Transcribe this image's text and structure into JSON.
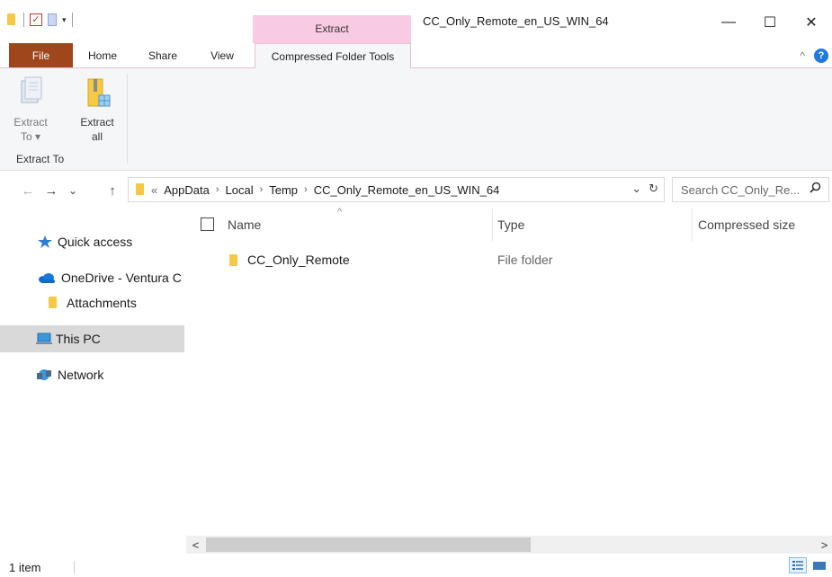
{
  "window": {
    "title": "CC_Only_Remote_en_US_WIN_64",
    "context_tab_header": "Extract",
    "controls": {
      "minimize": "—",
      "maximize": "☐",
      "close": "✕"
    }
  },
  "quick_access_toolbar": {
    "dropdown_glyph": "▾"
  },
  "ribbon": {
    "tabs": [
      "File",
      "Home",
      "Share",
      "View",
      "Compressed Folder Tools"
    ],
    "active_tab": "Compressed Folder Tools",
    "collapse_glyph": "^",
    "help_glyph": "?",
    "extract_to": {
      "line1": "Extract",
      "line2": "To ▾"
    },
    "extract_all": {
      "line1": "Extract",
      "line2": "all"
    },
    "group_label": "Extract To"
  },
  "navigation": {
    "back": "←",
    "forward": "→",
    "recent": "⌄",
    "up": "↑",
    "address": {
      "overflow": "«",
      "separator": "›",
      "crumbs": [
        "AppData",
        "Local",
        "Temp",
        "CC_Only_Remote_en_US_WIN_64"
      ],
      "dropdown": "⌄",
      "refresh": "↻"
    },
    "search_placeholder": "Search CC_Only_Re...",
    "search_icon": "⌕"
  },
  "nav_pane": {
    "items": [
      {
        "label": "Quick access",
        "icon": "star-icon"
      },
      {
        "label": "OneDrive - Ventura C",
        "icon": "cloud-icon"
      },
      {
        "label": "Attachments",
        "icon": "folder-icon"
      },
      {
        "label": "This PC",
        "icon": "computer-icon"
      },
      {
        "label": "Network",
        "icon": "network-icon"
      }
    ],
    "selected": "This PC"
  },
  "file_list": {
    "columns": [
      "Name",
      "Type",
      "Compressed size"
    ],
    "sort_indicator": "^",
    "rows": [
      {
        "name": "CC_Only_Remote",
        "type": "File folder"
      }
    ]
  },
  "scrollbar": {
    "left_arrow": "<",
    "right_arrow": ">"
  },
  "status": {
    "item_count": "1 item"
  },
  "colors": {
    "file_tab": "#a0461c",
    "context_tab": "#f8cbe3",
    "selection": "#d9d9d9",
    "folder": "#f6cd5b"
  }
}
